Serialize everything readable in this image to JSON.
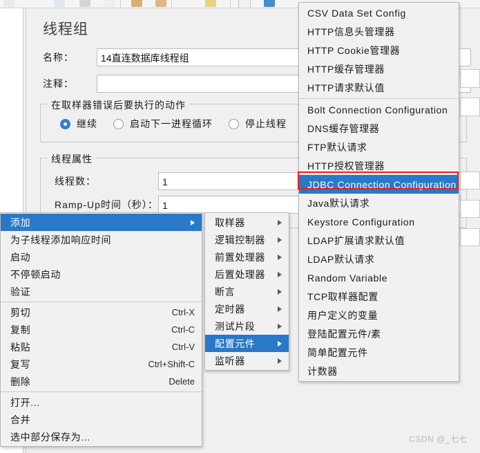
{
  "app": {
    "watermark": "CSDN @_七七"
  },
  "toolbar": {
    "icons": [
      {
        "name": "new-icon",
        "color": "#e8e8e8"
      },
      {
        "name": "templates-icon",
        "color": "#d9534f"
      },
      {
        "name": "open-icon",
        "color": "#cfcfcf"
      },
      {
        "name": "save-icon",
        "color": "#e0e0e0"
      },
      {
        "name": "cut-icon",
        "color": "#d9a05b"
      },
      {
        "name": "copy-icon",
        "color": "#dcab6b"
      },
      {
        "name": "paste-icon",
        "color": "#e7c96a"
      },
      {
        "name": "clear-icon",
        "color": "#e8e8e8"
      },
      {
        "name": "start-icon",
        "color": "#2879c8"
      }
    ]
  },
  "form": {
    "title": "线程组",
    "name_label": "名称：",
    "name_value": "14直连数据库线程组",
    "comment_label": "注释：",
    "comment_value": "",
    "error_group_title": "在取样器错误后要执行的动作",
    "error_options": [
      {
        "label": "继续",
        "selected": true
      },
      {
        "label": "启动下一进程循环",
        "selected": false
      },
      {
        "label": "停止线程",
        "selected": false
      },
      {
        "label": "",
        "selected": false
      }
    ],
    "props_group_title": "线程属性",
    "props": [
      {
        "label": "线程数：",
        "value": "1"
      },
      {
        "label": "Ramp-Up时间（秒）：",
        "value": "1"
      }
    ]
  },
  "context_menu": {
    "items": [
      {
        "label": "添加",
        "accel": "",
        "submenu": true,
        "selected": true
      },
      {
        "label": "为子线程添加响应时间",
        "accel": "",
        "submenu": false,
        "selected": false
      },
      {
        "label": "启动",
        "accel": "",
        "submenu": false,
        "selected": false
      },
      {
        "label": "不停顿启动",
        "accel": "",
        "submenu": false,
        "selected": false
      },
      {
        "label": "验证",
        "accel": "",
        "submenu": false,
        "selected": false
      },
      {
        "separator": true
      },
      {
        "label": "剪切",
        "accel": "Ctrl-X",
        "submenu": false,
        "selected": false
      },
      {
        "label": "复制",
        "accel": "Ctrl-C",
        "submenu": false,
        "selected": false
      },
      {
        "label": "粘贴",
        "accel": "Ctrl-V",
        "submenu": false,
        "selected": false
      },
      {
        "label": "复写",
        "accel": "Ctrl+Shift-C",
        "submenu": false,
        "selected": false
      },
      {
        "label": "删除",
        "accel": "Delete",
        "submenu": false,
        "selected": false
      },
      {
        "separator": true
      },
      {
        "label": "打开...",
        "accel": "",
        "submenu": false,
        "selected": false
      },
      {
        "label": "合并",
        "accel": "",
        "submenu": false,
        "selected": false
      },
      {
        "label": "选中部分保存为...",
        "accel": "",
        "submenu": false,
        "selected": false
      }
    ]
  },
  "add_menu": {
    "items": [
      {
        "label": "取样器",
        "submenu": true,
        "selected": false
      },
      {
        "label": "逻辑控制器",
        "submenu": true,
        "selected": false
      },
      {
        "label": "前置处理器",
        "submenu": true,
        "selected": false
      },
      {
        "label": "后置处理器",
        "submenu": true,
        "selected": false
      },
      {
        "label": "断言",
        "submenu": true,
        "selected": false
      },
      {
        "label": "定时器",
        "submenu": true,
        "selected": false
      },
      {
        "label": "测试片段",
        "submenu": true,
        "selected": false
      },
      {
        "label": "配置元件",
        "submenu": true,
        "selected": true
      },
      {
        "label": "监听器",
        "submenu": true,
        "selected": false
      }
    ]
  },
  "config_menu": {
    "items": [
      {
        "label": "CSV Data Set Config",
        "selected": false,
        "highlighted": false
      },
      {
        "label": "HTTP信息头管理器",
        "selected": false,
        "highlighted": false
      },
      {
        "label": "HTTP Cookie管理器",
        "selected": false,
        "highlighted": false
      },
      {
        "label": "HTTP缓存管理器",
        "selected": false,
        "highlighted": false
      },
      {
        "label": "HTTP请求默认值",
        "selected": false,
        "highlighted": false
      },
      {
        "separator": true
      },
      {
        "label": "Bolt Connection Configuration",
        "selected": false,
        "highlighted": false
      },
      {
        "label": "DNS缓存管理器",
        "selected": false,
        "highlighted": false
      },
      {
        "label": "FTP默认请求",
        "selected": false,
        "highlighted": false
      },
      {
        "label": "HTTP授权管理器",
        "selected": false,
        "highlighted": false
      },
      {
        "label": "JDBC Connection Configuration",
        "selected": true,
        "highlighted": true
      },
      {
        "label": "Java默认请求",
        "selected": false,
        "highlighted": false
      },
      {
        "label": "Keystore Configuration",
        "selected": false,
        "highlighted": false
      },
      {
        "label": "LDAP扩展请求默认值",
        "selected": false,
        "highlighted": false
      },
      {
        "label": "LDAP默认请求",
        "selected": false,
        "highlighted": false
      },
      {
        "label": "Random Variable",
        "selected": false,
        "highlighted": false
      },
      {
        "label": "TCP取样器配置",
        "selected": false,
        "highlighted": false
      },
      {
        "label": "用户定义的变量",
        "selected": false,
        "highlighted": false
      },
      {
        "label": "登陆配置元件/素",
        "selected": false,
        "highlighted": false
      },
      {
        "label": "简单配置元件",
        "selected": false,
        "highlighted": false
      },
      {
        "label": "计数器",
        "selected": false,
        "highlighted": false
      }
    ]
  },
  "colors": {
    "menu_selection": "#2879c8",
    "highlight_box": "#ee1d1d",
    "radio_selected": "#2f7fd1",
    "panel_bg": "#f0f0f0"
  }
}
